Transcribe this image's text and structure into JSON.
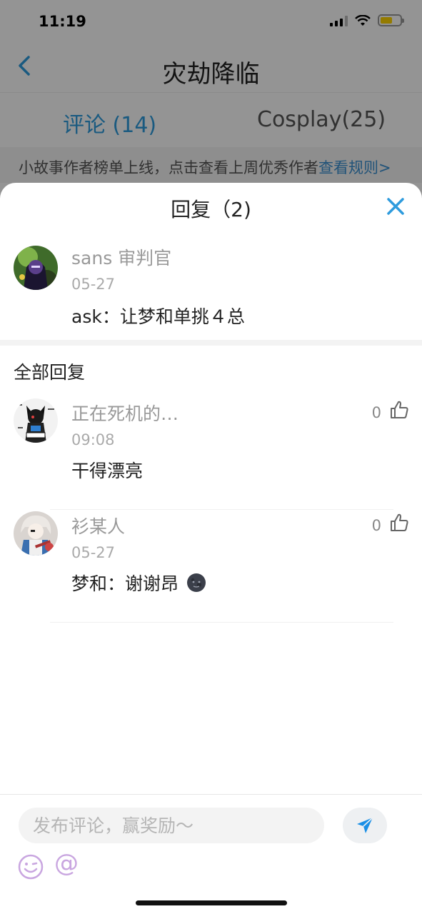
{
  "status_bar": {
    "time": "11:19"
  },
  "nav": {
    "title": "灾劫降临"
  },
  "tabs": [
    {
      "label": "评论 (14)"
    },
    {
      "label": "Cosplay(25)"
    }
  ],
  "notice": {
    "text": "小故事作者榜单上线，点击查看上周优秀作者",
    "link": "查看规则>"
  },
  "sheet": {
    "title": "回复（2)",
    "original": {
      "username": "sans 审判官",
      "date": "05-27",
      "content": "ask：让梦和单挑４总"
    },
    "section_title": "全部回复",
    "replies": [
      {
        "username": "正在死机的…",
        "date": "09:08",
        "content": "干得漂亮",
        "likes": "0"
      },
      {
        "username": "衫某人",
        "date": "05-27",
        "content": "梦和：谢谢昂",
        "likes": "0"
      }
    ]
  },
  "composer": {
    "placeholder": "发布评论，赢奖励～",
    "at_label": "@"
  },
  "colors": {
    "accent": "#2e9bdd",
    "send_icon": "#1a8fe6",
    "emoji_icon": "#c9a6e0"
  },
  "icons": [
    "back-icon",
    "close-icon",
    "like-icon",
    "send-icon",
    "emoji-icon",
    "at-icon",
    "signal-icon",
    "wifi-icon",
    "battery-icon",
    "new-moon-face-icon"
  ]
}
